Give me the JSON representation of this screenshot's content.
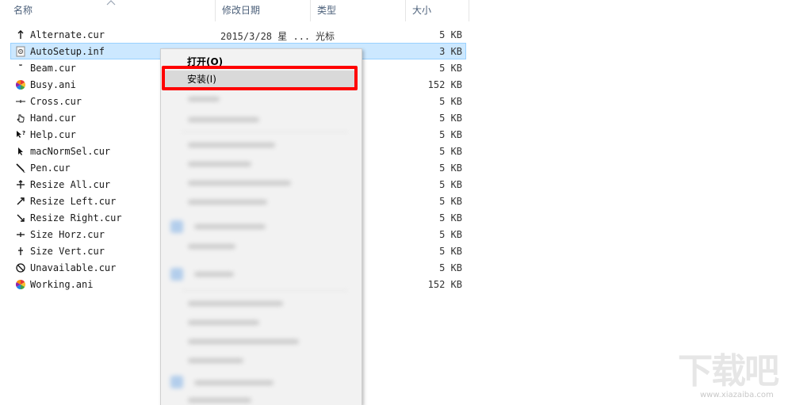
{
  "columns": {
    "name": "名称",
    "date": "修改日期",
    "type": "类型",
    "size": "大小"
  },
  "files": [
    {
      "name": "Alternate.cur",
      "date": "2015/3/28 星 ...",
      "type": "光标",
      "size": "5 KB",
      "icon": "arrow-up-cursor-icon",
      "selected": false
    },
    {
      "name": "AutoSetup.inf",
      "date": "",
      "type": "",
      "size": "3 KB",
      "icon": "setup-file-icon",
      "selected": true
    },
    {
      "name": "Beam.cur",
      "date": "",
      "type": "",
      "size": "5 KB",
      "icon": "beam-cursor-icon",
      "selected": false
    },
    {
      "name": "Busy.ani",
      "date": "",
      "type": "",
      "size": "152 KB",
      "icon": "busy-wheel-icon",
      "selected": false
    },
    {
      "name": "Cross.cur",
      "date": "",
      "type": "",
      "size": "5 KB",
      "icon": "cross-cursor-icon",
      "selected": false
    },
    {
      "name": "Hand.cur",
      "date": "",
      "type": "",
      "size": "5 KB",
      "icon": "hand-cursor-icon",
      "selected": false
    },
    {
      "name": "Help.cur",
      "date": "",
      "type": "",
      "size": "5 KB",
      "icon": "help-cursor-icon",
      "selected": false
    },
    {
      "name": "macNormSel.cur",
      "date": "",
      "type": "",
      "size": "5 KB",
      "icon": "arrow-cursor-icon",
      "selected": false
    },
    {
      "name": "Pen.cur",
      "date": "",
      "type": "",
      "size": "5 KB",
      "icon": "pen-cursor-icon",
      "selected": false
    },
    {
      "name": "Resize All.cur",
      "date": "",
      "type": "",
      "size": "5 KB",
      "icon": "resize-all-cursor-icon",
      "selected": false
    },
    {
      "name": "Resize Left.cur",
      "date": "",
      "type": "",
      "size": "5 KB",
      "icon": "resize-left-cursor-icon",
      "selected": false
    },
    {
      "name": "Resize Right.cur",
      "date": "",
      "type": "",
      "size": "5 KB",
      "icon": "resize-right-cursor-icon",
      "selected": false
    },
    {
      "name": "Size Horz.cur",
      "date": "",
      "type": "",
      "size": "5 KB",
      "icon": "size-horz-cursor-icon",
      "selected": false
    },
    {
      "name": "Size Vert.cur",
      "date": "",
      "type": "",
      "size": "5 KB",
      "icon": "size-vert-cursor-icon",
      "selected": false
    },
    {
      "name": "Unavailable.cur",
      "date": "",
      "type": "",
      "size": "5 KB",
      "icon": "unavailable-cursor-icon",
      "selected": false
    },
    {
      "name": "Working.ani",
      "date": "",
      "type": "",
      "size": "152 KB",
      "icon": "busy-wheel-icon",
      "selected": false
    }
  ],
  "context_menu": {
    "open_label": "打开(O)",
    "install_label": "安装(I)"
  },
  "watermark": {
    "logo_text": "下载吧",
    "url": "www.xiazaiba.com"
  },
  "colors": {
    "selection_bg": "#cce8ff",
    "selection_border": "#99d1ff",
    "highlight_box": "#ff0000",
    "header_text": "#4c607a"
  }
}
